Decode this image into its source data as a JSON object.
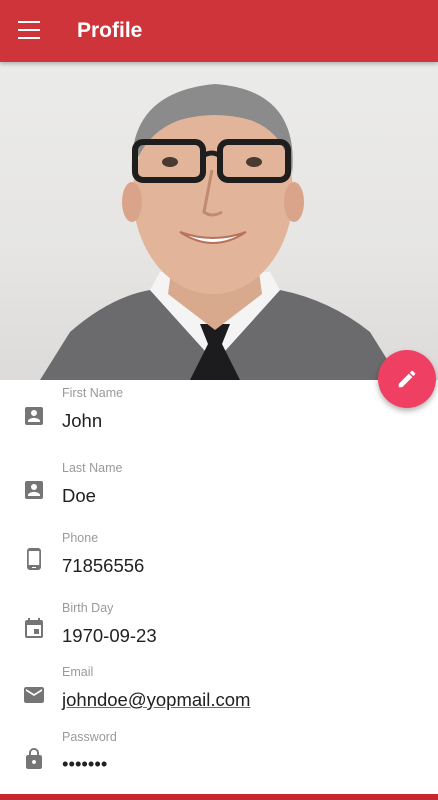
{
  "appbar": {
    "title": "Profile",
    "menu_icon": "menu-icon"
  },
  "fab": {
    "icon": "edit-pencil-icon"
  },
  "fields": [
    {
      "label": "First Name",
      "value": "John",
      "icon": "account-box-icon"
    },
    {
      "label": "Last Name",
      "value": "Doe",
      "icon": "account-box-icon"
    },
    {
      "label": "Phone",
      "value": "71856556",
      "icon": "phone-icon"
    },
    {
      "label": "Birth Day",
      "value": "1970-09-23",
      "icon": "calendar-icon"
    },
    {
      "label": "Email",
      "value": "johndoe@yopmail.com",
      "icon": "email-icon"
    },
    {
      "label": "Password",
      "value": "•••••••",
      "icon": "lock-icon"
    }
  ],
  "colors": {
    "appbar": "#d0343b",
    "fab": "#ef4064",
    "icon": "#757575",
    "label": "#9a9a9a",
    "value": "#212121"
  }
}
